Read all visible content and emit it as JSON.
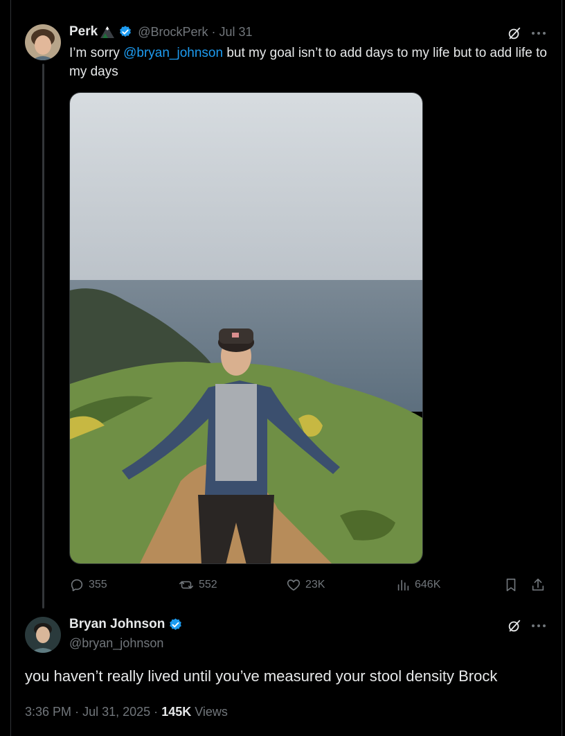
{
  "tweet": {
    "author_name": "Perk",
    "author_emoji": "mountain-icon",
    "handle": "@BrockPerk",
    "separator": "·",
    "date": "Jul 31",
    "text_before": "I’m sorry ",
    "mention": "@bryan_johnson",
    "text_after": " but my goal isn’t to add days to my life but to add life to my days",
    "photo_description": "man-on-coastal-hillside-photo",
    "actions": {
      "replies": "355",
      "reposts": "552",
      "likes": "23K",
      "views": "646K"
    }
  },
  "reply": {
    "author_name": "Bryan Johnson",
    "handle": "@bryan_johnson",
    "text": "you haven’t really lived until you’ve measured your stool density Brock",
    "time": "3:36 PM",
    "dot1": "·",
    "date": "Jul 31, 2025",
    "dot2": "·",
    "views_count": "145K",
    "views_label": "Views"
  },
  "colors": {
    "background": "#000000",
    "text": "#e7e9ea",
    "muted": "#71767b",
    "link": "#1d9bf0",
    "verified": "#1d9bf0",
    "border": "#2f3336"
  }
}
